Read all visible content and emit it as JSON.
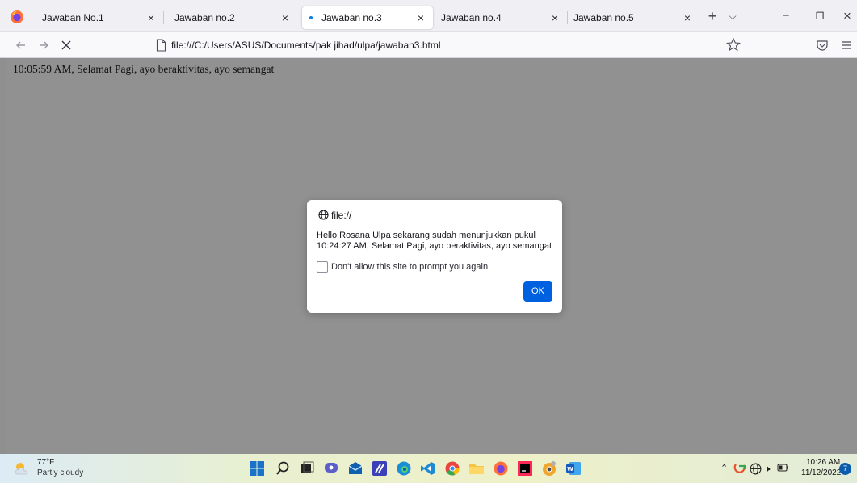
{
  "browser": {
    "tabs": [
      {
        "label": "Jawaban No.1",
        "active": false
      },
      {
        "label": "Jawaban no.2",
        "active": false
      },
      {
        "label": "Jawaban no.3",
        "active": true
      },
      {
        "label": "Jawaban no.4",
        "active": false
      },
      {
        "label": "Jawaban no.5",
        "active": false
      }
    ],
    "close_glyph": "×",
    "new_tab_glyph": "+",
    "list_tabs_glyph": "⌵",
    "minimize_glyph": "−",
    "restore_glyph": "❐",
    "window_close_glyph": "×",
    "url": "file:///C:/Users/ASUS/Documents/pak jihad/ulpa/jawaban3.html",
    "accent_color": "#0061e0"
  },
  "page": {
    "text": "10:05:59 AM, Selamat Pagi, ayo beraktivitas, ayo semangat"
  },
  "dialog": {
    "origin": "file://",
    "message": "Hello Rosana Ulpa sekarang sudah menunjukkan pukul 10:24:27 AM, Selamat Pagi, ayo beraktivitas, ayo semangat",
    "checkbox_label": "Don't allow this site to prompt you again",
    "checkbox_checked": false,
    "ok_label": "OK"
  },
  "taskbar": {
    "temperature": "77°F",
    "condition": "Partly cloudy",
    "apps": [
      "windows-start",
      "search",
      "task-view",
      "chat",
      "mail",
      "photos-editor",
      "edge",
      "vscode",
      "chrome",
      "file-explorer",
      "firefox",
      "intellij",
      "chrome-canary",
      "word"
    ],
    "clock_time": "10:26 AM",
    "clock_date": "11/12/2022",
    "notification_count": "7"
  }
}
